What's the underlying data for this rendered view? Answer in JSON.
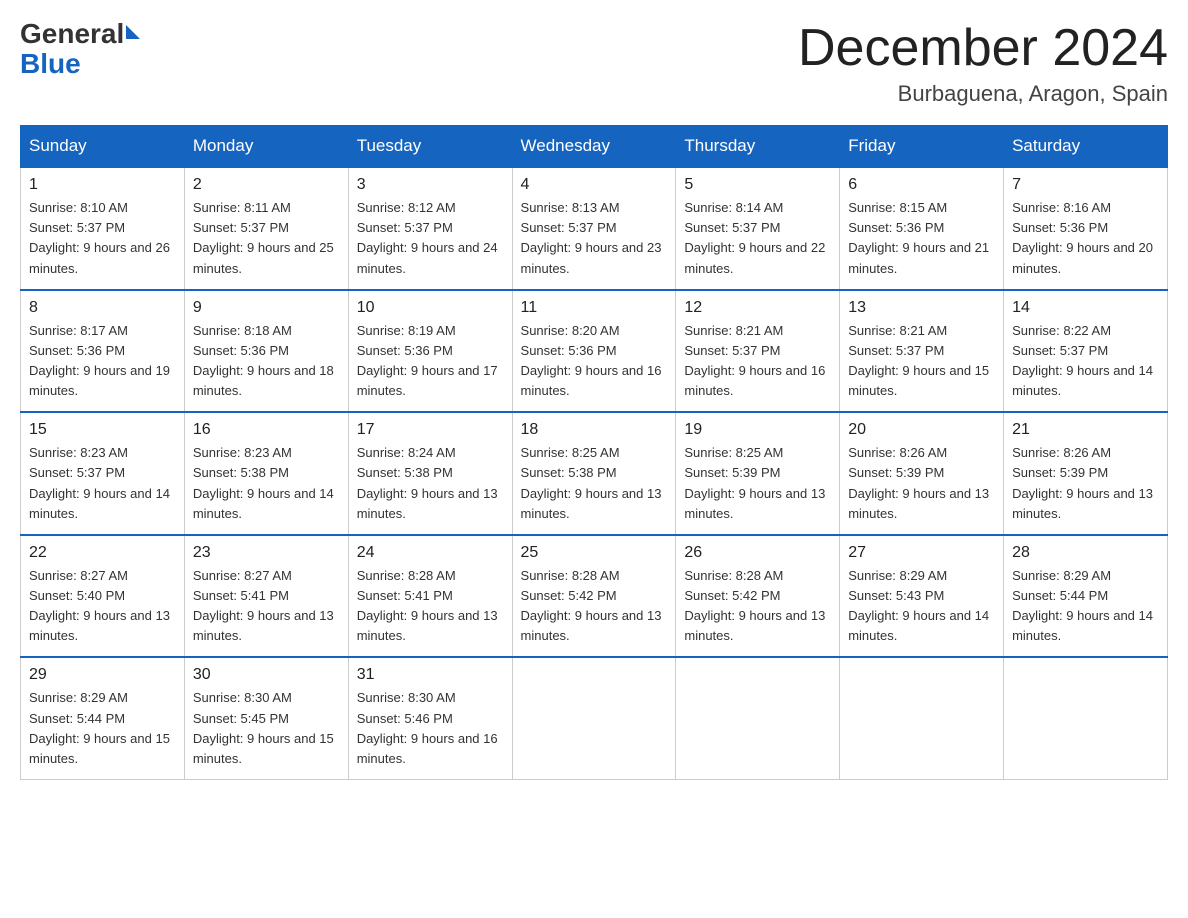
{
  "header": {
    "logo_general": "General",
    "logo_blue": "Blue",
    "month_title": "December 2024",
    "location": "Burbaguena, Aragon, Spain"
  },
  "days_of_week": [
    "Sunday",
    "Monday",
    "Tuesday",
    "Wednesday",
    "Thursday",
    "Friday",
    "Saturday"
  ],
  "weeks": [
    [
      {
        "day": "1",
        "sunrise": "8:10 AM",
        "sunset": "5:37 PM",
        "daylight": "9 hours and 26 minutes."
      },
      {
        "day": "2",
        "sunrise": "8:11 AM",
        "sunset": "5:37 PM",
        "daylight": "9 hours and 25 minutes."
      },
      {
        "day": "3",
        "sunrise": "8:12 AM",
        "sunset": "5:37 PM",
        "daylight": "9 hours and 24 minutes."
      },
      {
        "day": "4",
        "sunrise": "8:13 AM",
        "sunset": "5:37 PM",
        "daylight": "9 hours and 23 minutes."
      },
      {
        "day": "5",
        "sunrise": "8:14 AM",
        "sunset": "5:37 PM",
        "daylight": "9 hours and 22 minutes."
      },
      {
        "day": "6",
        "sunrise": "8:15 AM",
        "sunset": "5:36 PM",
        "daylight": "9 hours and 21 minutes."
      },
      {
        "day": "7",
        "sunrise": "8:16 AM",
        "sunset": "5:36 PM",
        "daylight": "9 hours and 20 minutes."
      }
    ],
    [
      {
        "day": "8",
        "sunrise": "8:17 AM",
        "sunset": "5:36 PM",
        "daylight": "9 hours and 19 minutes."
      },
      {
        "day": "9",
        "sunrise": "8:18 AM",
        "sunset": "5:36 PM",
        "daylight": "9 hours and 18 minutes."
      },
      {
        "day": "10",
        "sunrise": "8:19 AM",
        "sunset": "5:36 PM",
        "daylight": "9 hours and 17 minutes."
      },
      {
        "day": "11",
        "sunrise": "8:20 AM",
        "sunset": "5:36 PM",
        "daylight": "9 hours and 16 minutes."
      },
      {
        "day": "12",
        "sunrise": "8:21 AM",
        "sunset": "5:37 PM",
        "daylight": "9 hours and 16 minutes."
      },
      {
        "day": "13",
        "sunrise": "8:21 AM",
        "sunset": "5:37 PM",
        "daylight": "9 hours and 15 minutes."
      },
      {
        "day": "14",
        "sunrise": "8:22 AM",
        "sunset": "5:37 PM",
        "daylight": "9 hours and 14 minutes."
      }
    ],
    [
      {
        "day": "15",
        "sunrise": "8:23 AM",
        "sunset": "5:37 PM",
        "daylight": "9 hours and 14 minutes."
      },
      {
        "day": "16",
        "sunrise": "8:23 AM",
        "sunset": "5:38 PM",
        "daylight": "9 hours and 14 minutes."
      },
      {
        "day": "17",
        "sunrise": "8:24 AM",
        "sunset": "5:38 PM",
        "daylight": "9 hours and 13 minutes."
      },
      {
        "day": "18",
        "sunrise": "8:25 AM",
        "sunset": "5:38 PM",
        "daylight": "9 hours and 13 minutes."
      },
      {
        "day": "19",
        "sunrise": "8:25 AM",
        "sunset": "5:39 PM",
        "daylight": "9 hours and 13 minutes."
      },
      {
        "day": "20",
        "sunrise": "8:26 AM",
        "sunset": "5:39 PM",
        "daylight": "9 hours and 13 minutes."
      },
      {
        "day": "21",
        "sunrise": "8:26 AM",
        "sunset": "5:39 PM",
        "daylight": "9 hours and 13 minutes."
      }
    ],
    [
      {
        "day": "22",
        "sunrise": "8:27 AM",
        "sunset": "5:40 PM",
        "daylight": "9 hours and 13 minutes."
      },
      {
        "day": "23",
        "sunrise": "8:27 AM",
        "sunset": "5:41 PM",
        "daylight": "9 hours and 13 minutes."
      },
      {
        "day": "24",
        "sunrise": "8:28 AM",
        "sunset": "5:41 PM",
        "daylight": "9 hours and 13 minutes."
      },
      {
        "day": "25",
        "sunrise": "8:28 AM",
        "sunset": "5:42 PM",
        "daylight": "9 hours and 13 minutes."
      },
      {
        "day": "26",
        "sunrise": "8:28 AM",
        "sunset": "5:42 PM",
        "daylight": "9 hours and 13 minutes."
      },
      {
        "day": "27",
        "sunrise": "8:29 AM",
        "sunset": "5:43 PM",
        "daylight": "9 hours and 14 minutes."
      },
      {
        "day": "28",
        "sunrise": "8:29 AM",
        "sunset": "5:44 PM",
        "daylight": "9 hours and 14 minutes."
      }
    ],
    [
      {
        "day": "29",
        "sunrise": "8:29 AM",
        "sunset": "5:44 PM",
        "daylight": "9 hours and 15 minutes."
      },
      {
        "day": "30",
        "sunrise": "8:30 AM",
        "sunset": "5:45 PM",
        "daylight": "9 hours and 15 minutes."
      },
      {
        "day": "31",
        "sunrise": "8:30 AM",
        "sunset": "5:46 PM",
        "daylight": "9 hours and 16 minutes."
      },
      null,
      null,
      null,
      null
    ]
  ]
}
